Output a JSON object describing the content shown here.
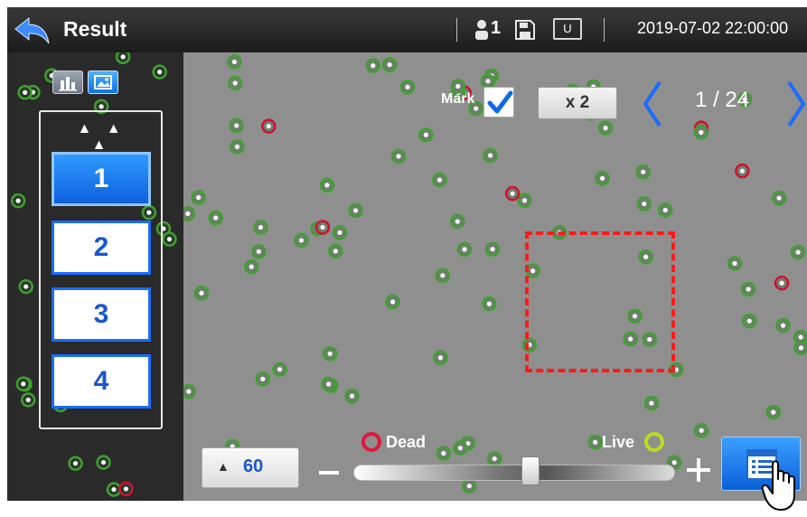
{
  "header": {
    "title": "Result",
    "user_count": "1",
    "usb_label": "U",
    "datetime": "2019-07-02 22:00:00"
  },
  "left_panel": {
    "scroll_up_label": "▲ ▲ ▲",
    "channels": [
      "1",
      "2",
      "3",
      "4"
    ],
    "active_channel": "1"
  },
  "image_view": {
    "mark_label": "Mark",
    "mark_checked": true,
    "zoom_label": "x 2",
    "page_indicator": "1 / 24"
  },
  "bottom_controls": {
    "threshold_value": "60",
    "dead_label": "Dead",
    "live_label": "Live",
    "slider_level": 0.55
  },
  "colors": {
    "accent_blue": "#0e6ae4",
    "dead_red": "#e0163b",
    "live_green": "#b9de1e",
    "roi_red": "#ff1a1a"
  },
  "icons": [
    "back-arrow-icon",
    "user-icon",
    "save-icon",
    "usb-icon",
    "bar-chart-icon",
    "image-icon",
    "checkmark-icon",
    "chevron-left-icon",
    "chevron-right-icon",
    "chevron-up-icon",
    "minus-icon",
    "plus-icon",
    "report-list-icon",
    "hand-cursor-icon"
  ]
}
